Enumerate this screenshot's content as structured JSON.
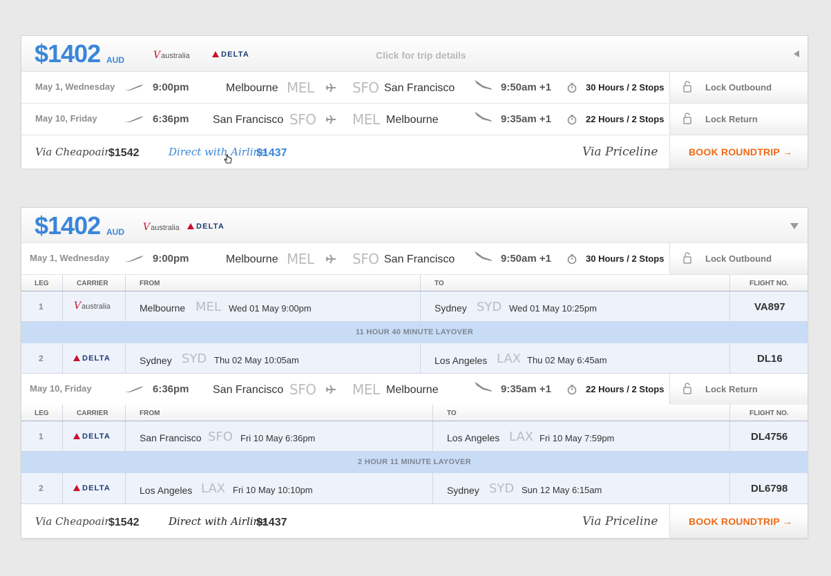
{
  "card1": {
    "price": "$1402",
    "currency": "AUD",
    "carriers": [
      "australia",
      "DELTA"
    ],
    "details_label": "Click for trip details",
    "outbound": {
      "date": "May 1, Wednesday",
      "depart_time": "9:00pm",
      "from_city": "Melbourne",
      "from_code": "MEL",
      "to_code": "SFO",
      "to_city": "San Francisco",
      "arrive_time": "9:50am +1",
      "duration": "30 Hours / 2 Stops",
      "lock_label": "Lock Outbound"
    },
    "return": {
      "date": "May 10, Friday",
      "depart_time": "6:36pm",
      "from_city": "San Francisco",
      "from_code": "SFO",
      "to_code": "MEL",
      "to_city": "Melbourne",
      "arrive_time": "9:35am +1",
      "duration": "22 Hours / 2 Stops",
      "lock_label": "Lock Return"
    },
    "footer": {
      "via_cheapoair": "Via Cheapoair",
      "cheapoair_price": "$1542",
      "direct": "Direct with Airline",
      "direct_price": "$1437",
      "priceline": "Via Priceline",
      "book": "BOOK ROUNDTRIP"
    }
  },
  "card2": {
    "price": "$1402",
    "currency": "AUD",
    "carriers": [
      "australia",
      "DELTA"
    ],
    "outbound": {
      "date": "May 1, Wednesday",
      "depart_time": "9:00pm",
      "from_city": "Melbourne",
      "from_code": "MEL",
      "to_code": "SFO",
      "to_city": "San Francisco",
      "arrive_time": "9:50am +1",
      "duration": "30 Hours / 2 Stops",
      "lock_label": "Lock Outbound"
    },
    "table_headers": {
      "leg": "LEG",
      "carrier": "CARRIER",
      "from": "FROM",
      "to": "TO",
      "flight": "FLIGHT NO."
    },
    "outbound_legs": [
      {
        "leg": "1",
        "carrier": "australia",
        "from_city": "Melbourne",
        "from_code": "MEL",
        "from_date": "Wed 01 May 9:00pm",
        "to_city": "Sydney",
        "to_code": "SYD",
        "to_date": "Wed 01 May 10:25pm",
        "flight": "VA897"
      },
      {
        "leg": "2",
        "carrier": "DELTA",
        "from_city": "Sydney",
        "from_code": "SYD",
        "from_date": "Thu 02 May 10:05am",
        "to_city": "Los Angeles",
        "to_code": "LAX",
        "to_date": "Thu 02 May 6:45am",
        "flight": "DL16"
      }
    ],
    "outbound_layover": "11 HOUR 40 MINUTE LAYOVER",
    "return": {
      "date": "May 10, Friday",
      "depart_time": "6:36pm",
      "from_city": "San Francisco",
      "from_code": "SFO",
      "to_code": "MEL",
      "to_city": "Melbourne",
      "arrive_time": "9:35am +1",
      "duration": "22 Hours / 2 Stops",
      "lock_label": "Lock Return"
    },
    "return_legs": [
      {
        "leg": "1",
        "carrier": "DELTA",
        "from_city": "San Francisco",
        "from_code": "SFO",
        "from_date": "Fri 10 May 6:36pm",
        "to_city": "Los Angeles",
        "to_code": "LAX",
        "to_date": "Fri 10 May 7:59pm",
        "flight": "DL4756"
      },
      {
        "leg": "2",
        "carrier": "DELTA",
        "from_city": "Los Angeles",
        "from_code": "LAX",
        "from_date": "Fri 10 May 10:10pm",
        "to_city": "Sydney",
        "to_code": "SYD",
        "to_date": "Sun 12 May 6:15am",
        "flight": "DL6798"
      }
    ],
    "return_layover": "2 HOUR 11 MINUTE LAYOVER",
    "footer": {
      "via_cheapoair": "Via Cheapoair",
      "cheapoair_price": "$1542",
      "direct": "Direct with Airline",
      "direct_price": "$1437",
      "priceline": "Via Priceline",
      "book": "BOOK ROUNDTRIP"
    }
  },
  "colors": {
    "accent_blue": "#3a86d8",
    "book_orange": "#ee6a17",
    "layover_bg": "#c8dcf5",
    "delta_blue": "#1b3c74",
    "virgin_red": "#c8102e"
  },
  "icons": [
    "takeoff-icon",
    "plane-icon",
    "landing-icon",
    "stopwatch-icon",
    "lock-icon",
    "arrow-right-icon",
    "collapse-arrow-icon",
    "expand-arrow-icon",
    "cursor-hand-icon"
  ]
}
